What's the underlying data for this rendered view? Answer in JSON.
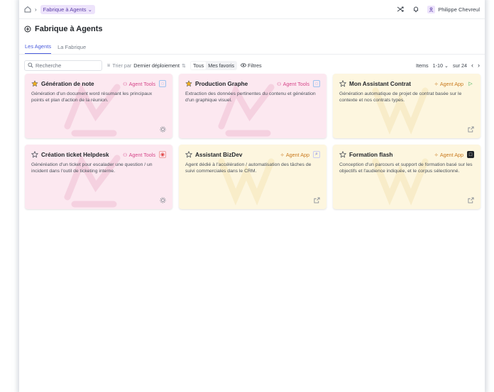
{
  "breadcrumb": {
    "current": "Fabrique à Agents"
  },
  "header": {
    "user_name": "Philippe Chevreul"
  },
  "page": {
    "title": "Fabrique à Agents"
  },
  "tabs": [
    {
      "label": "Les Agents"
    },
    {
      "label": "La Fabrique"
    }
  ],
  "toolbar": {
    "search_placeholder": "Recherche",
    "sort_prefix": "Trier par",
    "sort_value": "Dernier déploiement",
    "filter_all": "Tous",
    "filter_fav": "Mes favoris",
    "filters_label": "Filtres",
    "items_label": "Items",
    "items_range": "1-10",
    "items_total": "sur 24"
  },
  "colors": {
    "accent": "#4a5bdc",
    "tools": "#d6478a",
    "app": "#c97a1e",
    "tools_bg": "#fce8f0",
    "app_bg": "#fdf6df"
  },
  "cards": [
    {
      "title": "Génération de note",
      "badge": "Agent Tools",
      "type": "tools",
      "favorite": true,
      "tool_icon": "copilot-icon",
      "desc": "Génération d'un document word résumant les principaux points et plan d'action de la réunion.",
      "footer_icon": "gear-icon"
    },
    {
      "title": "Production Graphe",
      "badge": "Agent Tools",
      "type": "tools",
      "favorite": true,
      "tool_icon": "copilot-icon",
      "desc": "Extraction des données pertinentes du contenu et génération d'un graphique visuel.",
      "footer_icon": "none"
    },
    {
      "title": "Mon Assistant Contrat",
      "badge": "Agent App",
      "type": "app",
      "favorite": false,
      "tool_icon": "play-icon",
      "desc": "Génération automatique de projet de contrat basée sur le contexte et nos contrats types.",
      "footer_icon": "external-link-icon"
    },
    {
      "title": "Création ticket Helpdesk",
      "badge": "Agent Tools",
      "type": "tools",
      "favorite": false,
      "tool_icon": "target-icon",
      "desc": "Généréation d'un ticket pour escalader une question / un incident dans l'outil de ticketing interne.",
      "footer_icon": "gear-icon"
    },
    {
      "title": "Assistant BizDev",
      "badge": "Agent App",
      "type": "app",
      "favorite": false,
      "tool_icon": "search-icon",
      "desc": "Agent dédié à l'accélération / automatisation des tâches de suivi commerciales dans le CRM.",
      "footer_icon": "external-link-icon"
    },
    {
      "title": "Formation flash",
      "badge": "Agent App",
      "type": "app",
      "favorite": false,
      "tool_icon": "square-icon",
      "desc": "Conception d'un parcours et support de formation basé sur les objectifs et l'audience indiquée, et le corpus sélectionné.",
      "footer_icon": "external-link-icon"
    }
  ]
}
